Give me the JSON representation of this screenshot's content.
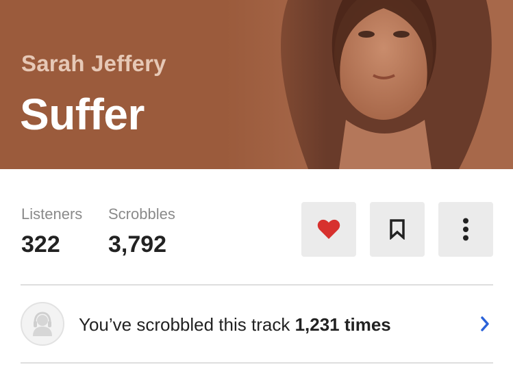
{
  "header": {
    "artist": "Sarah Jeffery",
    "title": "Suffer",
    "background_color": "#9b5b3c"
  },
  "stats": {
    "listeners_label": "Listeners",
    "listeners_value": "322",
    "scrobbles_label": "Scrobbles",
    "scrobbles_value": "3,792"
  },
  "actions": [
    {
      "name": "love",
      "icon": "heart-icon",
      "color": "#d7312e"
    },
    {
      "name": "save",
      "icon": "bookmark-icon",
      "color": "#222222"
    },
    {
      "name": "more",
      "icon": "more-vertical-icon",
      "color": "#222222"
    }
  ],
  "scrobble_row": {
    "prefix": "You’ve scrobbled this track",
    "count_text": "1,231 times",
    "accent_color": "#2a62d9"
  }
}
